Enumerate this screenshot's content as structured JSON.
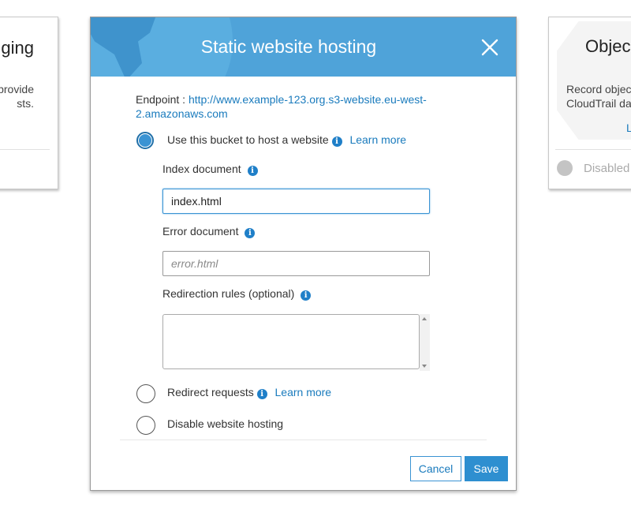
{
  "left_card": {
    "title": "ging",
    "desc_line1": "provide",
    "desc_line2": "sts."
  },
  "right_card": {
    "title": "Objec",
    "desc_line1": "Record objec",
    "desc_line2": "CloudTrail da",
    "link": "L",
    "radio_label": "Disabled"
  },
  "modal": {
    "title": "Static website hosting",
    "endpoint_label": "Endpoint : ",
    "endpoint_url_line1": "http://www.example-123.org.s3-website.eu-west-",
    "endpoint_url_line2": "2.amazonaws.com",
    "options": {
      "host": "Use this bucket to host a website",
      "redirect": "Redirect requests",
      "disable": "Disable website hosting"
    },
    "learn_more": "Learn more",
    "index_document": {
      "label": "Index document",
      "value": "index.html"
    },
    "error_document": {
      "label": "Error document",
      "placeholder": "error.html"
    },
    "redirection_rules": {
      "label": "Redirection rules (optional)",
      "value": ""
    },
    "buttons": {
      "cancel": "Cancel",
      "save": "Save"
    }
  },
  "colors": {
    "header_bg": "#4fa3d9",
    "link": "#1a7bbd",
    "primary_button": "#2e8fd0"
  },
  "icons": {
    "close": "close-icon",
    "info": "info-icon"
  }
}
